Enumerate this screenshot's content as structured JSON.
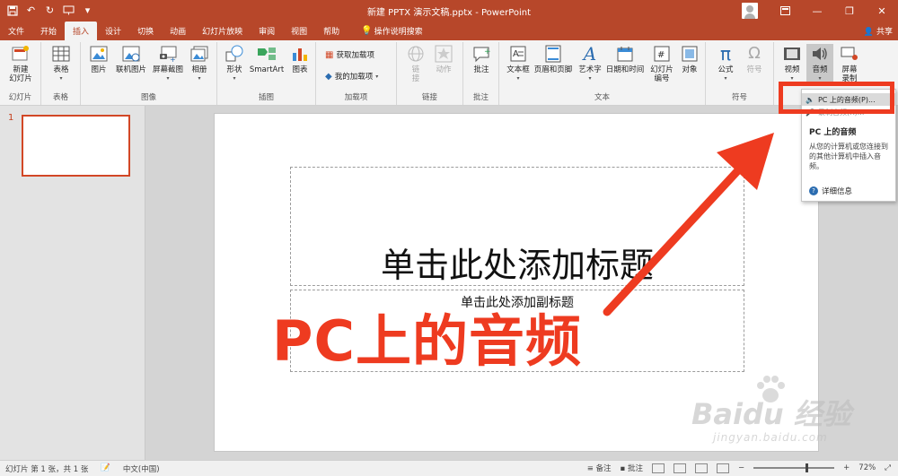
{
  "window": {
    "title": "新建 PPTX 演示文稿.pptx  -  PowerPoint",
    "controls": [
      "ribbon-display-options-icon",
      "minimize-icon",
      "restore-icon",
      "close-icon"
    ]
  },
  "qat": [
    "save-icon",
    "undo-icon",
    "redo-icon",
    "start-from-beginning-icon",
    "customize-qat-icon"
  ],
  "tabs": [
    {
      "label": "文件",
      "active": false
    },
    {
      "label": "开始",
      "active": false
    },
    {
      "label": "插入",
      "active": true
    },
    {
      "label": "设计",
      "active": false
    },
    {
      "label": "切换",
      "active": false
    },
    {
      "label": "动画",
      "active": false
    },
    {
      "label": "幻灯片放映",
      "active": false
    },
    {
      "label": "审阅",
      "active": false
    },
    {
      "label": "视图",
      "active": false
    },
    {
      "label": "帮助",
      "active": false
    }
  ],
  "tellme": "操作说明搜索",
  "share": "共享",
  "ribbon": {
    "groups": {
      "slides": {
        "label": "幻灯片",
        "new_slide": "新建\n幻灯片"
      },
      "tables": {
        "label": "表格",
        "table": "表格"
      },
      "images": {
        "label": "图像",
        "picture": "图片",
        "online_picture": "联机图片",
        "screenshot": "屏幕截图",
        "album": "相册"
      },
      "illustrations": {
        "label": "插图",
        "shapes": "形状",
        "smartart": "SmartArt",
        "chart": "图表"
      },
      "addins": {
        "label": "加载项",
        "get_addins": "获取加载项",
        "my_addins": "我的加载项"
      },
      "links": {
        "label": "链接",
        "link": "链\n接",
        "action": "动作"
      },
      "comments": {
        "label": "批注",
        "comment": "批注"
      },
      "text": {
        "label": "文本",
        "textbox": "文本框",
        "header_footer": "页眉和页脚",
        "wordart": "艺术字",
        "datetime": "日期和时间",
        "slide_number": "幻灯片\n编号",
        "object": "对象"
      },
      "symbols": {
        "label": "符号",
        "equation": "公式",
        "symbol": "符号"
      },
      "media": {
        "video": "视频",
        "audio": "音频",
        "screen_recording": "屏幕\n录制"
      }
    }
  },
  "thumbnails": [
    {
      "number": "1"
    }
  ],
  "slide": {
    "title_placeholder": "单击此处添加标题",
    "subtitle_placeholder": "单击此处添加副标题"
  },
  "overlay_caption": "PC上的音频",
  "audio_menu": {
    "items": [
      {
        "label": "PC 上的音频(P)...",
        "highlighted": true
      },
      {
        "label": "录制音频(R)...",
        "highlighted": false
      }
    ],
    "tooltip_title": "PC 上的音频",
    "tooltip_desc": "从您的计算机或您连接到的其他计算机中插入音频。",
    "more_info": "详细信息"
  },
  "status": {
    "slide_info": "幻灯片 第 1 张，共 1 张",
    "language": "中文(中国)",
    "notes": "备注",
    "comments": "批注",
    "zoom": "72%"
  },
  "watermark": {
    "main": "Baidu 经验",
    "sub": "jingyan.baidu.com"
  },
  "colors": {
    "accent": "#b7472a",
    "annotation": "#ee3b20"
  }
}
